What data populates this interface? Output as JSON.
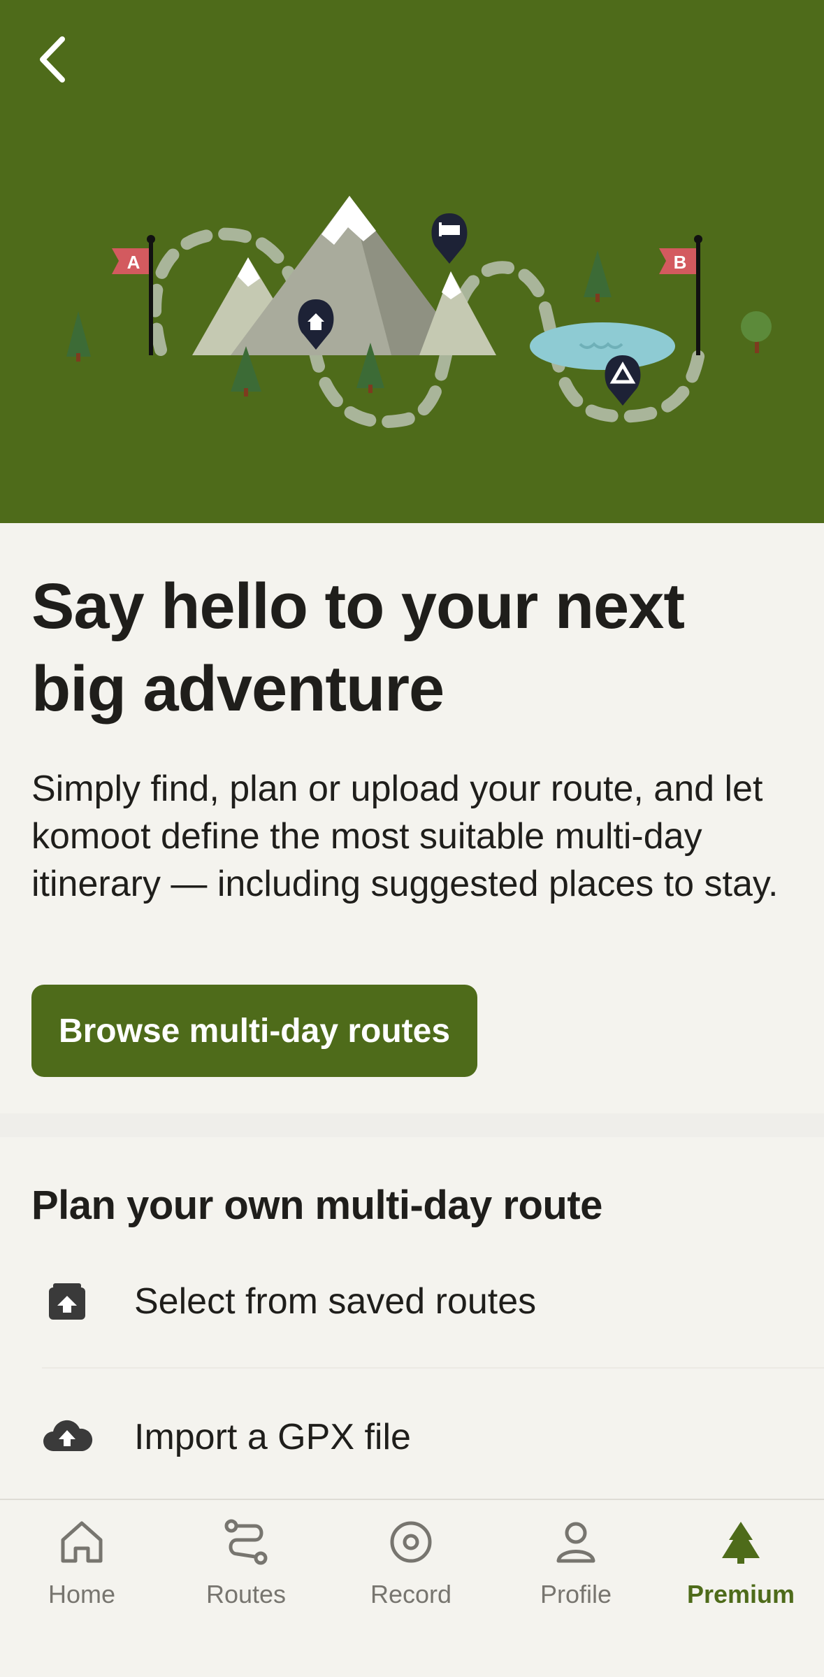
{
  "hero": {
    "back_icon": "chevron-left-icon",
    "colors": {
      "background": "#4e6b1a",
      "flag": "#d35a5f",
      "pin": "#1d2236",
      "lake": "#8ecbd3"
    },
    "flag_start_label": "A",
    "flag_end_label": "B"
  },
  "main": {
    "headline": "Say hello to your next big adventure",
    "intro": "Simply find, plan or upload your route, and let komoot define the most suitable multi-day itinerary — including suggested places to stay.",
    "cta_label": "Browse multi-day routes"
  },
  "plan": {
    "title": "Plan your own multi-day route",
    "options": [
      {
        "label": "Select from saved routes",
        "icon": "saved-routes-icon"
      },
      {
        "label": "Import a GPX file",
        "icon": "cloud-upload-icon"
      }
    ]
  },
  "tabbar": {
    "active": "Premium",
    "accent": "#4e6b1a",
    "tabs": [
      {
        "label": "Home",
        "icon": "home-icon"
      },
      {
        "label": "Routes",
        "icon": "routes-icon"
      },
      {
        "label": "Record",
        "icon": "record-icon"
      },
      {
        "label": "Profile",
        "icon": "profile-icon"
      },
      {
        "label": "Premium",
        "icon": "tree-icon"
      }
    ]
  }
}
